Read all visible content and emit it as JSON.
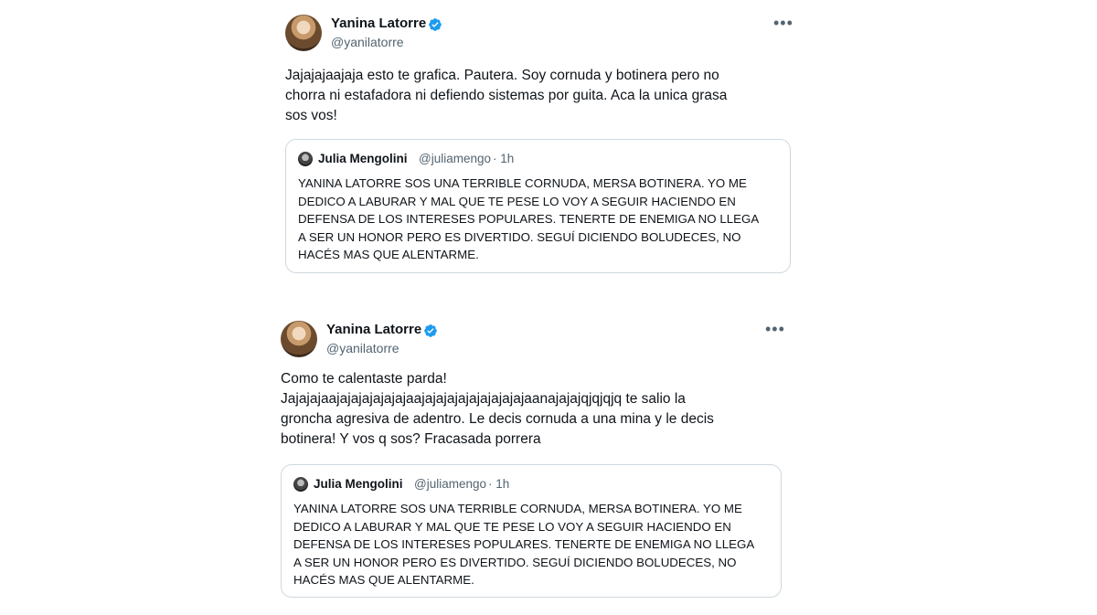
{
  "tweets": [
    {
      "author": "Yanina Latorre",
      "handle": "@yanilatorre",
      "text": "Jajajajaajaja esto te grafica. Pautera. Soy cornuda y botinera pero no\nchorra ni estafadora ni defiendo sistemas por guita. Aca la unica grasa\nsos vos!",
      "quote": {
        "author": "Julia Mengolini",
        "handle": "@juliamengo",
        "time": "· 1h",
        "text": "YANINA LATORRE SOS UNA TERRIBLE CORNUDA, MERSA BOTINERA. YO ME\nDEDICO A LABURAR Y MAL QUE TE PESE LO VOY A SEGUIR HACIENDO EN\nDEFENSA DE LOS INTERESES POPULARES. TENERTE DE ENEMIGA NO LLEGA\nA SER UN HONOR PERO ES DIVERTIDO. SEGUÍ DICIENDO BOLUDECES, NO\nHACÉS MAS QUE ALENTARME."
      }
    },
    {
      "author": "Yanina Latorre",
      "handle": "@yanilatorre",
      "text": "Como te calentaste parda!\nJajajajaajajajajajajajaajajajajajajajajajajaanajajajqjqjqjq te salio la\ngroncha agresiva de adentro. Le decis cornuda a una mina y le decis\nbotinera! Y vos q sos? Fracasada porrera",
      "quote": {
        "author": "Julia Mengolini",
        "handle": "@juliamengo",
        "time": "· 1h",
        "text": "YANINA LATORRE SOS UNA TERRIBLE CORNUDA, MERSA BOTINERA. YO ME\nDEDICO A LABURAR Y MAL QUE TE PESE LO VOY A SEGUIR HACIENDO EN\nDEFENSA DE LOS INTERESES POPULARES. TENERTE DE ENEMIGA NO LLEGA\nA SER UN HONOR PERO ES DIVERTIDO. SEGUÍ DICIENDO BOLUDECES, NO\nHACÉS MAS QUE ALENTARME."
      }
    }
  ],
  "icons": {
    "verified": "verified-badge-icon",
    "more": "more-options-icon"
  },
  "colors": {
    "verified": "#1d9bf0",
    "secondary_text": "#536471",
    "border": "#cfd9de"
  }
}
